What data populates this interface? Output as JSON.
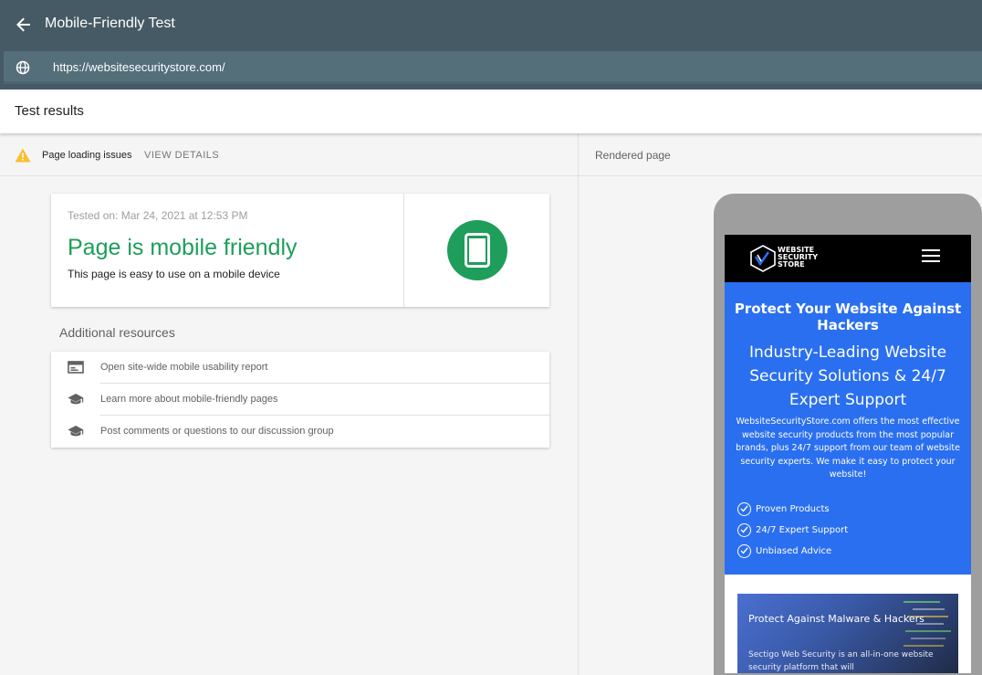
{
  "app": {
    "title": "Mobile-Friendly Test",
    "url": "https://websitesecuritystore.com/"
  },
  "results": {
    "title": "Test results",
    "issues_label": "Page loading issues",
    "view_details": "VIEW DETAILS",
    "tested_on": "Tested on: Mar 24, 2021 at 12:53 PM",
    "verdict": "Page is mobile friendly",
    "verdict_sub": "This page is easy to use on a mobile device",
    "status_color": "#1e9e5a",
    "warning_color": "#f9bf2d"
  },
  "resources": {
    "heading": "Additional resources",
    "items": [
      {
        "label": "Open site-wide mobile usability report",
        "icon": "report-icon"
      },
      {
        "label": "Learn more about mobile-friendly pages",
        "icon": "school-icon"
      },
      {
        "label": "Post comments or questions to our discussion group",
        "icon": "school-icon"
      }
    ]
  },
  "rendered": {
    "label": "Rendered page",
    "site": {
      "logo_lines": [
        "WEBSITE",
        "SECURITY",
        "STORE"
      ],
      "hero_title": "Protect Your Website Against Hackers",
      "hero_subtitle": "Industry-Leading Website Security Solutions & 24/7 Expert Support",
      "hero_text": "WebsiteSecurityStore.com offers the most effective website security products from the most popular brands, plus 24/7 support from our team of website security experts. We make it easy to protect your website!",
      "features": [
        "Proven Products",
        "24/7 Expert Support",
        "Unbiased Advice"
      ],
      "promo_title": "Protect Against Malware & Hackers",
      "promo_text": "Sectigo Web Security is an all-in-one website security platform that will",
      "accent_color": "#2a6ff0"
    }
  }
}
